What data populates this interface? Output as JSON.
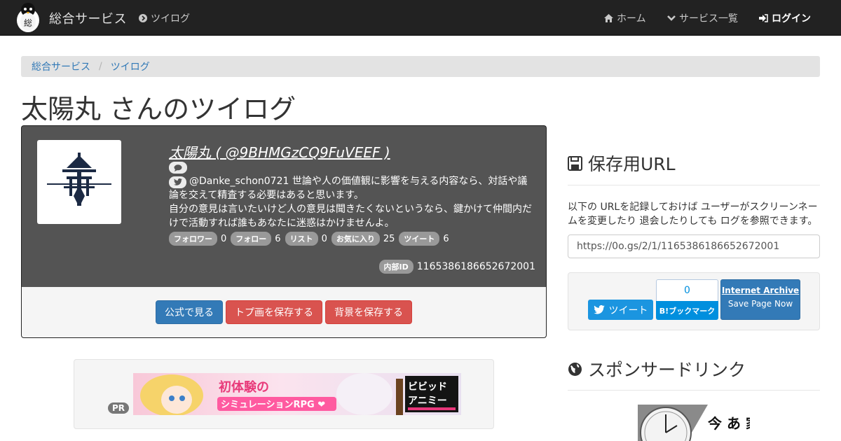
{
  "nav": {
    "brand": "総合サービス",
    "twilog": "ツイログ",
    "home": "ホーム",
    "services": "サービス一覧",
    "login": "ログイン"
  },
  "breadcrumb": [
    "総合サービス",
    "ツイログ"
  ],
  "page_title": "太陽丸 さんのツイログ",
  "profile": {
    "name_link": "太陽丸 ( @9BHMGzCQ9FuVEEF )",
    "bio_line1": "@Danke_schon0721 世論や人の価値観に影響を与える内容なら、対話や議論を交えて精査する必要はあると思います。",
    "bio_line2": "自分の意見は言いたいけど人の意見は聞きたくないというなら、鍵かけて仲間内だけで活動すれば誰もあなたに迷惑はかけませんよ。",
    "stats": [
      {
        "label": "フォロワー",
        "value": "0"
      },
      {
        "label": "フォロー",
        "value": "6"
      },
      {
        "label": "リスト",
        "value": "0"
      },
      {
        "label": "お気に入り",
        "value": "25"
      },
      {
        "label": "ツイート",
        "value": "6"
      }
    ],
    "internal_id_label": "内部ID",
    "internal_id": "1165386186652672001"
  },
  "buttons": {
    "official": "公式で見る",
    "save_avatar": "トプ画を保存する",
    "save_bg": "背景を保存する"
  },
  "pr": {
    "badge": "PR",
    "banner_line1": "初体験の",
    "banner_line2": "シミュレーションRPG ❤",
    "banner_logo1": "ビビッド",
    "banner_logo2": "アニミー"
  },
  "sidebar": {
    "save_heading": "保存用URL",
    "description": "以下の URLを記録しておけば ユーザーがスクリーンネームを変更したり 退会したりしても ログを参照できます。",
    "url": "https://0o.gs/2/1/1165386186652672001",
    "tweet": "ツイート",
    "hatena_count": "0",
    "hatena_label": "B!ブックマーク",
    "ia_title": "Internet Archive",
    "ia_sub": "Save Page Now",
    "sponsor_heading": "スポンサードリンク",
    "sponsor_text": "今 あ 家 ."
  },
  "colors": {
    "navbar": "#222222",
    "profile_bg": "#545454",
    "primary": "#337ab7",
    "danger": "#d9534f",
    "twitter": "#1b95e0",
    "hatena": "#008fde"
  }
}
